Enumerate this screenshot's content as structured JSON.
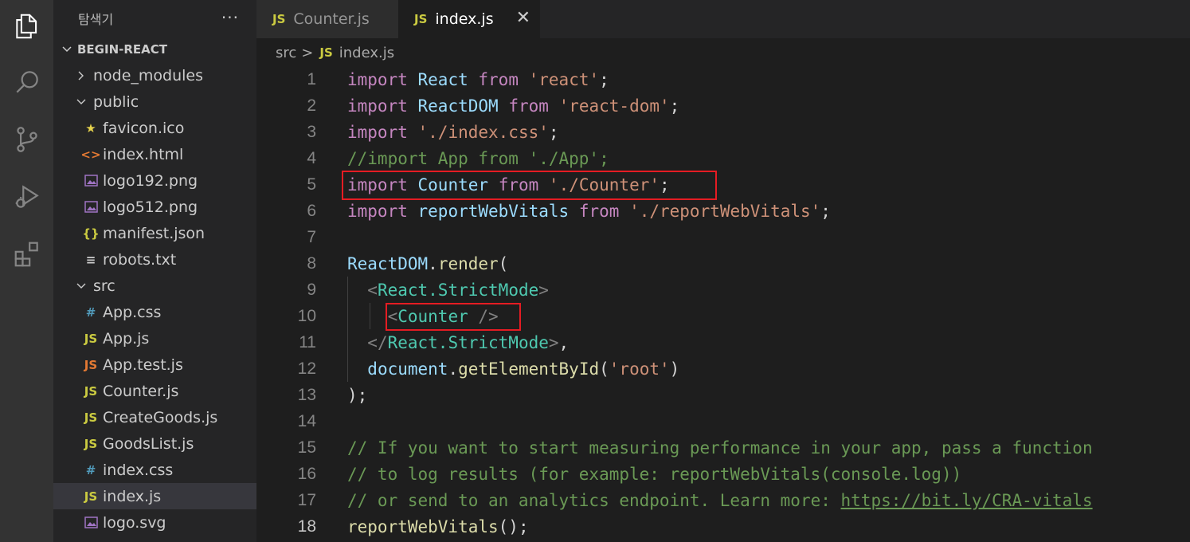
{
  "explorer": {
    "title": "탐색기",
    "more": "···",
    "root": "BEGIN-REACT",
    "items": [
      {
        "label": "node_modules",
        "type": "folder",
        "expanded": false,
        "depth": 1,
        "icon": ""
      },
      {
        "label": "public",
        "type": "folder",
        "expanded": true,
        "depth": 1,
        "icon": ""
      },
      {
        "label": "favicon.ico",
        "type": "file",
        "depth": 2,
        "icon": "★",
        "icon_color": "#e8d44d"
      },
      {
        "label": "index.html",
        "type": "file",
        "depth": 2,
        "icon": "<>",
        "icon_color": "#e37933"
      },
      {
        "label": "logo192.png",
        "type": "file",
        "depth": 2,
        "icon": "img",
        "icon_color": "#a074c4"
      },
      {
        "label": "logo512.png",
        "type": "file",
        "depth": 2,
        "icon": "img",
        "icon_color": "#a074c4"
      },
      {
        "label": "manifest.json",
        "type": "file",
        "depth": 2,
        "icon": "{}",
        "icon_color": "#cbcb41"
      },
      {
        "label": "robots.txt",
        "type": "file",
        "depth": 2,
        "icon": "≡",
        "icon_color": "#cccccc"
      },
      {
        "label": "src",
        "type": "folder",
        "expanded": true,
        "depth": 1,
        "icon": ""
      },
      {
        "label": "App.css",
        "type": "file",
        "depth": 2,
        "icon": "#",
        "icon_color": "#519aba"
      },
      {
        "label": "App.js",
        "type": "file",
        "depth": 2,
        "icon": "JS",
        "icon_color": "#cbcb41"
      },
      {
        "label": "App.test.js",
        "type": "file",
        "depth": 2,
        "icon": "JS",
        "icon_color": "#e37933"
      },
      {
        "label": "Counter.js",
        "type": "file",
        "depth": 2,
        "icon": "JS",
        "icon_color": "#cbcb41"
      },
      {
        "label": "CreateGoods.js",
        "type": "file",
        "depth": 2,
        "icon": "JS",
        "icon_color": "#cbcb41"
      },
      {
        "label": "GoodsList.js",
        "type": "file",
        "depth": 2,
        "icon": "JS",
        "icon_color": "#cbcb41"
      },
      {
        "label": "index.css",
        "type": "file",
        "depth": 2,
        "icon": "#",
        "icon_color": "#519aba"
      },
      {
        "label": "index.js",
        "type": "file",
        "depth": 2,
        "icon": "JS",
        "icon_color": "#cbcb41",
        "active": true
      },
      {
        "label": "logo.svg",
        "type": "file",
        "depth": 2,
        "icon": "img",
        "icon_color": "#a074c4"
      }
    ]
  },
  "tabs": [
    {
      "label": "Counter.js",
      "badge": "JS",
      "active": false
    },
    {
      "label": "index.js",
      "badge": "JS",
      "active": true,
      "close": "✕"
    }
  ],
  "breadcrumb": {
    "folder": "src",
    "sep": ">",
    "badge": "JS",
    "file": "index.js"
  },
  "code": {
    "current_line": 18,
    "lines": [
      {
        "n": "1",
        "tokens": [
          [
            "kw",
            "import"
          ],
          [
            "pn",
            " "
          ],
          [
            "id",
            "React"
          ],
          [
            "pn",
            " "
          ],
          [
            "kw",
            "from"
          ],
          [
            "pn",
            " "
          ],
          [
            "str",
            "'react'"
          ],
          [
            "pn",
            ";"
          ]
        ]
      },
      {
        "n": "2",
        "tokens": [
          [
            "kw",
            "import"
          ],
          [
            "pn",
            " "
          ],
          [
            "id",
            "ReactDOM"
          ],
          [
            "pn",
            " "
          ],
          [
            "kw",
            "from"
          ],
          [
            "pn",
            " "
          ],
          [
            "str",
            "'react-dom'"
          ],
          [
            "pn",
            ";"
          ]
        ]
      },
      {
        "n": "3",
        "tokens": [
          [
            "kw",
            "import"
          ],
          [
            "pn",
            " "
          ],
          [
            "str",
            "'./index.css'"
          ],
          [
            "pn",
            ";"
          ]
        ]
      },
      {
        "n": "4",
        "tokens": [
          [
            "cm",
            "//import App from './App';"
          ]
        ]
      },
      {
        "n": "5",
        "tokens": [
          [
            "kw",
            "import"
          ],
          [
            "pn",
            " "
          ],
          [
            "id",
            "Counter"
          ],
          [
            "pn",
            " "
          ],
          [
            "kw",
            "from"
          ],
          [
            "pn",
            " "
          ],
          [
            "str",
            "'./Counter'"
          ],
          [
            "pn",
            ";"
          ]
        ]
      },
      {
        "n": "6",
        "tokens": [
          [
            "kw",
            "import"
          ],
          [
            "pn",
            " "
          ],
          [
            "id",
            "reportWebVitals"
          ],
          [
            "pn",
            " "
          ],
          [
            "kw",
            "from"
          ],
          [
            "pn",
            " "
          ],
          [
            "str",
            "'./reportWebVitals'"
          ],
          [
            "pn",
            ";"
          ]
        ]
      },
      {
        "n": "7",
        "tokens": []
      },
      {
        "n": "8",
        "tokens": [
          [
            "id",
            "ReactDOM"
          ],
          [
            "pn",
            "."
          ],
          [
            "fn",
            "render"
          ],
          [
            "pn",
            "("
          ]
        ]
      },
      {
        "n": "9",
        "tokens": [
          [
            "pn",
            "  "
          ],
          [
            "br",
            "<"
          ],
          [
            "tag",
            "React.StrictMode"
          ],
          [
            "br",
            ">"
          ]
        ]
      },
      {
        "n": "10",
        "tokens": [
          [
            "pn",
            "    "
          ],
          [
            "br",
            "<"
          ],
          [
            "tag",
            "Counter"
          ],
          [
            "pn",
            " "
          ],
          [
            "br",
            "/>"
          ]
        ]
      },
      {
        "n": "11",
        "tokens": [
          [
            "pn",
            "  "
          ],
          [
            "br",
            "</"
          ],
          [
            "tag",
            "React.StrictMode"
          ],
          [
            "br",
            ">"
          ],
          [
            "pn",
            ","
          ]
        ]
      },
      {
        "n": "12",
        "tokens": [
          [
            "pn",
            "  "
          ],
          [
            "dv",
            "document"
          ],
          [
            "pn",
            "."
          ],
          [
            "fn",
            "getElementById"
          ],
          [
            "pn",
            "("
          ],
          [
            "str",
            "'root'"
          ],
          [
            "pn",
            ")"
          ]
        ]
      },
      {
        "n": "13",
        "tokens": [
          [
            "pn",
            ");"
          ]
        ]
      },
      {
        "n": "14",
        "tokens": []
      },
      {
        "n": "15",
        "tokens": [
          [
            "cm",
            "// If you want to start measuring performance in your app, pass a function"
          ]
        ]
      },
      {
        "n": "16",
        "tokens": [
          [
            "cm",
            "// to log results (for example: reportWebVitals(console.log))"
          ]
        ]
      },
      {
        "n": "17",
        "tokens": [
          [
            "cm",
            "// or send to an analytics endpoint. Learn more: "
          ],
          [
            "url",
            "https://bit.ly/CRA-vitals"
          ]
        ]
      },
      {
        "n": "18",
        "tokens": [
          [
            "fn",
            "reportWebVitals"
          ],
          [
            "pn",
            "();"
          ]
        ]
      }
    ]
  },
  "colors": {
    "highlight_box": "#e51c23",
    "activity_bar": "#333333",
    "sidebar": "#252526",
    "editor": "#1e1e1e"
  },
  "activity_icons": [
    "explorer-icon",
    "search-icon",
    "source-control-icon",
    "run-debug-icon",
    "extensions-icon"
  ]
}
